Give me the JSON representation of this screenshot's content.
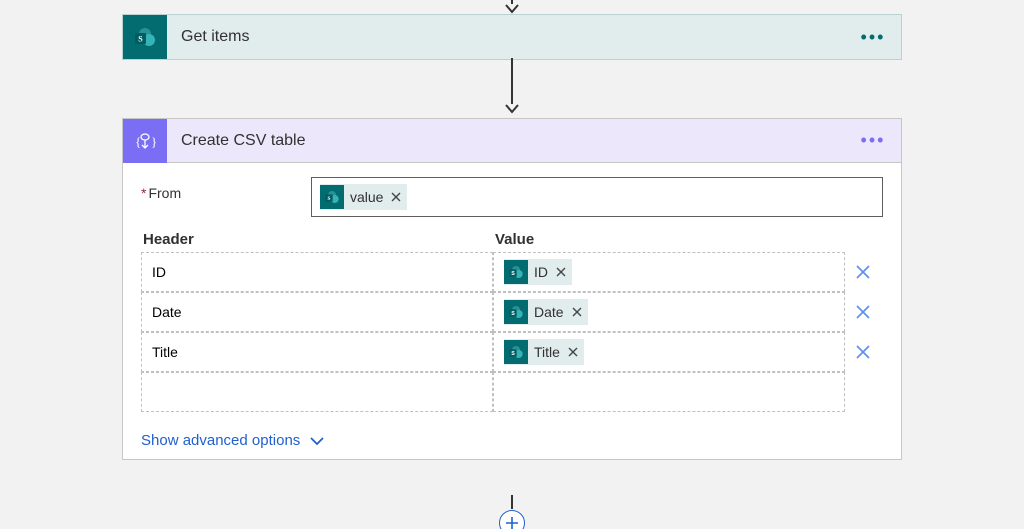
{
  "actions": {
    "get_items": {
      "title": "Get items"
    },
    "create_csv": {
      "title": "Create CSV table",
      "from_label": "From",
      "from_token": "value",
      "header_col": "Header",
      "value_col": "Value",
      "rows": [
        {
          "header": "ID",
          "value_token": "ID"
        },
        {
          "header": "Date",
          "value_token": "Date"
        },
        {
          "header": "Title",
          "value_token": "Title"
        }
      ],
      "show_advanced": "Show advanced options"
    }
  }
}
